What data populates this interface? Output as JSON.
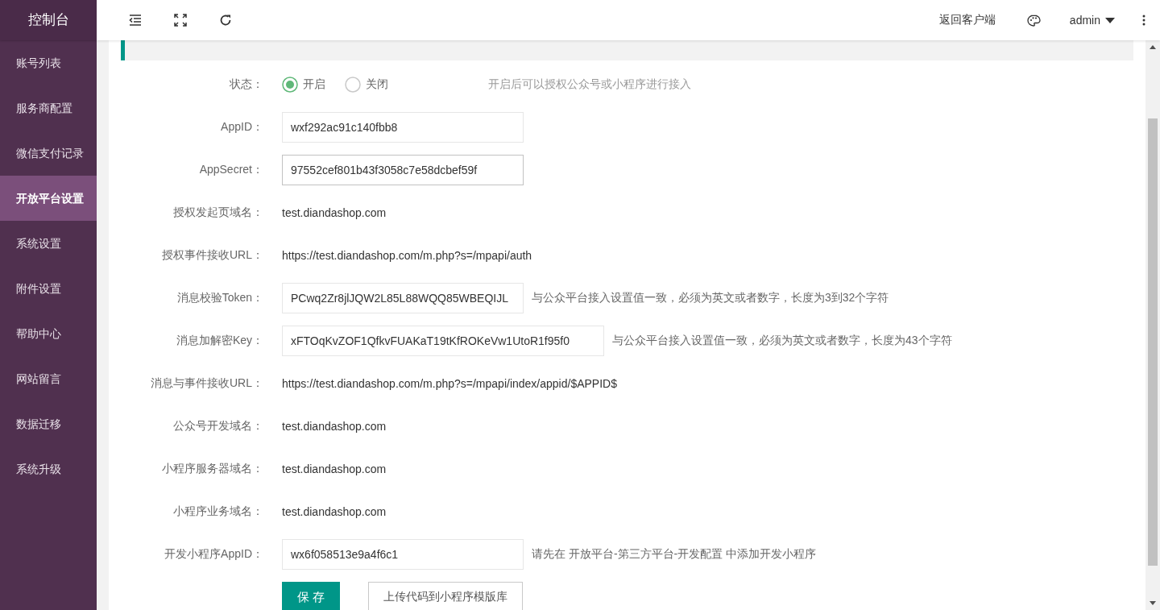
{
  "sidebar": {
    "title": "控制台",
    "items": [
      {
        "label": "账号列表",
        "selected": false
      },
      {
        "label": "服务商配置",
        "selected": false
      },
      {
        "label": "微信支付记录",
        "selected": false
      },
      {
        "label": "开放平台设置",
        "selected": true
      },
      {
        "label": "系统设置",
        "selected": false
      },
      {
        "label": "附件设置",
        "selected": false
      },
      {
        "label": "帮助中心",
        "selected": false
      },
      {
        "label": "网站留言",
        "selected": false
      },
      {
        "label": "数据迁移",
        "selected": false
      },
      {
        "label": "系统升级",
        "selected": false
      }
    ]
  },
  "header": {
    "back_link": "返回客户端",
    "user": "admin"
  },
  "notice": {
    "kind": "info"
  },
  "form": {
    "rows": [
      {
        "kind": "radio",
        "label": "状态：",
        "options": [
          {
            "label": "开启",
            "selected": true
          },
          {
            "label": "关闭",
            "selected": false
          }
        ],
        "hint": "开启后可以授权公众号或小程序进行接入"
      },
      {
        "kind": "input",
        "label": "AppID：",
        "value": "wxf292ac91c140fbb8",
        "focused": false
      },
      {
        "kind": "input",
        "label": "AppSecret：",
        "value": "97552cef801b43f3058c7e58dcbef59f",
        "focused": true
      },
      {
        "kind": "text",
        "label": "授权发起页域名：",
        "value": "test.diandashop.com"
      },
      {
        "kind": "text",
        "label": "授权事件接收URL：",
        "value": "https://test.diandashop.com/m.php?s=/mpapi/auth"
      },
      {
        "kind": "input",
        "label": "消息校验Token：",
        "value": "PCwq2Zr8jlJQW2L85L88WQQ85WBEQIJL",
        "focused": false,
        "hint": "与公众平台接入设置值一致，必须为英文或者数字，长度为3到32个字符"
      },
      {
        "kind": "wide-input",
        "label": "消息加解密Key：",
        "value": "xFTOqKvZOF1QfkvFUAKaT19tKfROKeVw1UtoR1f95f0",
        "focused": false,
        "hint": "与公众平台接入设置值一致，必须为英文或者数字，长度为43个字符"
      },
      {
        "kind": "text",
        "label": "消息与事件接收URL：",
        "value": "https://test.diandashop.com/m.php?s=/mpapi/index/appid/$APPID$"
      },
      {
        "kind": "text",
        "label": "公众号开发域名：",
        "value": "test.diandashop.com"
      },
      {
        "kind": "text",
        "label": "小程序服务器域名：",
        "value": "test.diandashop.com"
      },
      {
        "kind": "text",
        "label": "小程序业务域名：",
        "value": "test.diandashop.com"
      },
      {
        "kind": "input",
        "label": "开发小程序AppID：",
        "value": "wx6f058513e9a4f6c1",
        "focused": false,
        "hint": "请先在 开放平台-第三方平台-开发配置 中添加开发小程序"
      }
    ],
    "buttons": [
      {
        "kind": "primary",
        "label": "保 存"
      },
      {
        "kind": "default",
        "label": "上传代码到小程序模版库"
      }
    ]
  }
}
